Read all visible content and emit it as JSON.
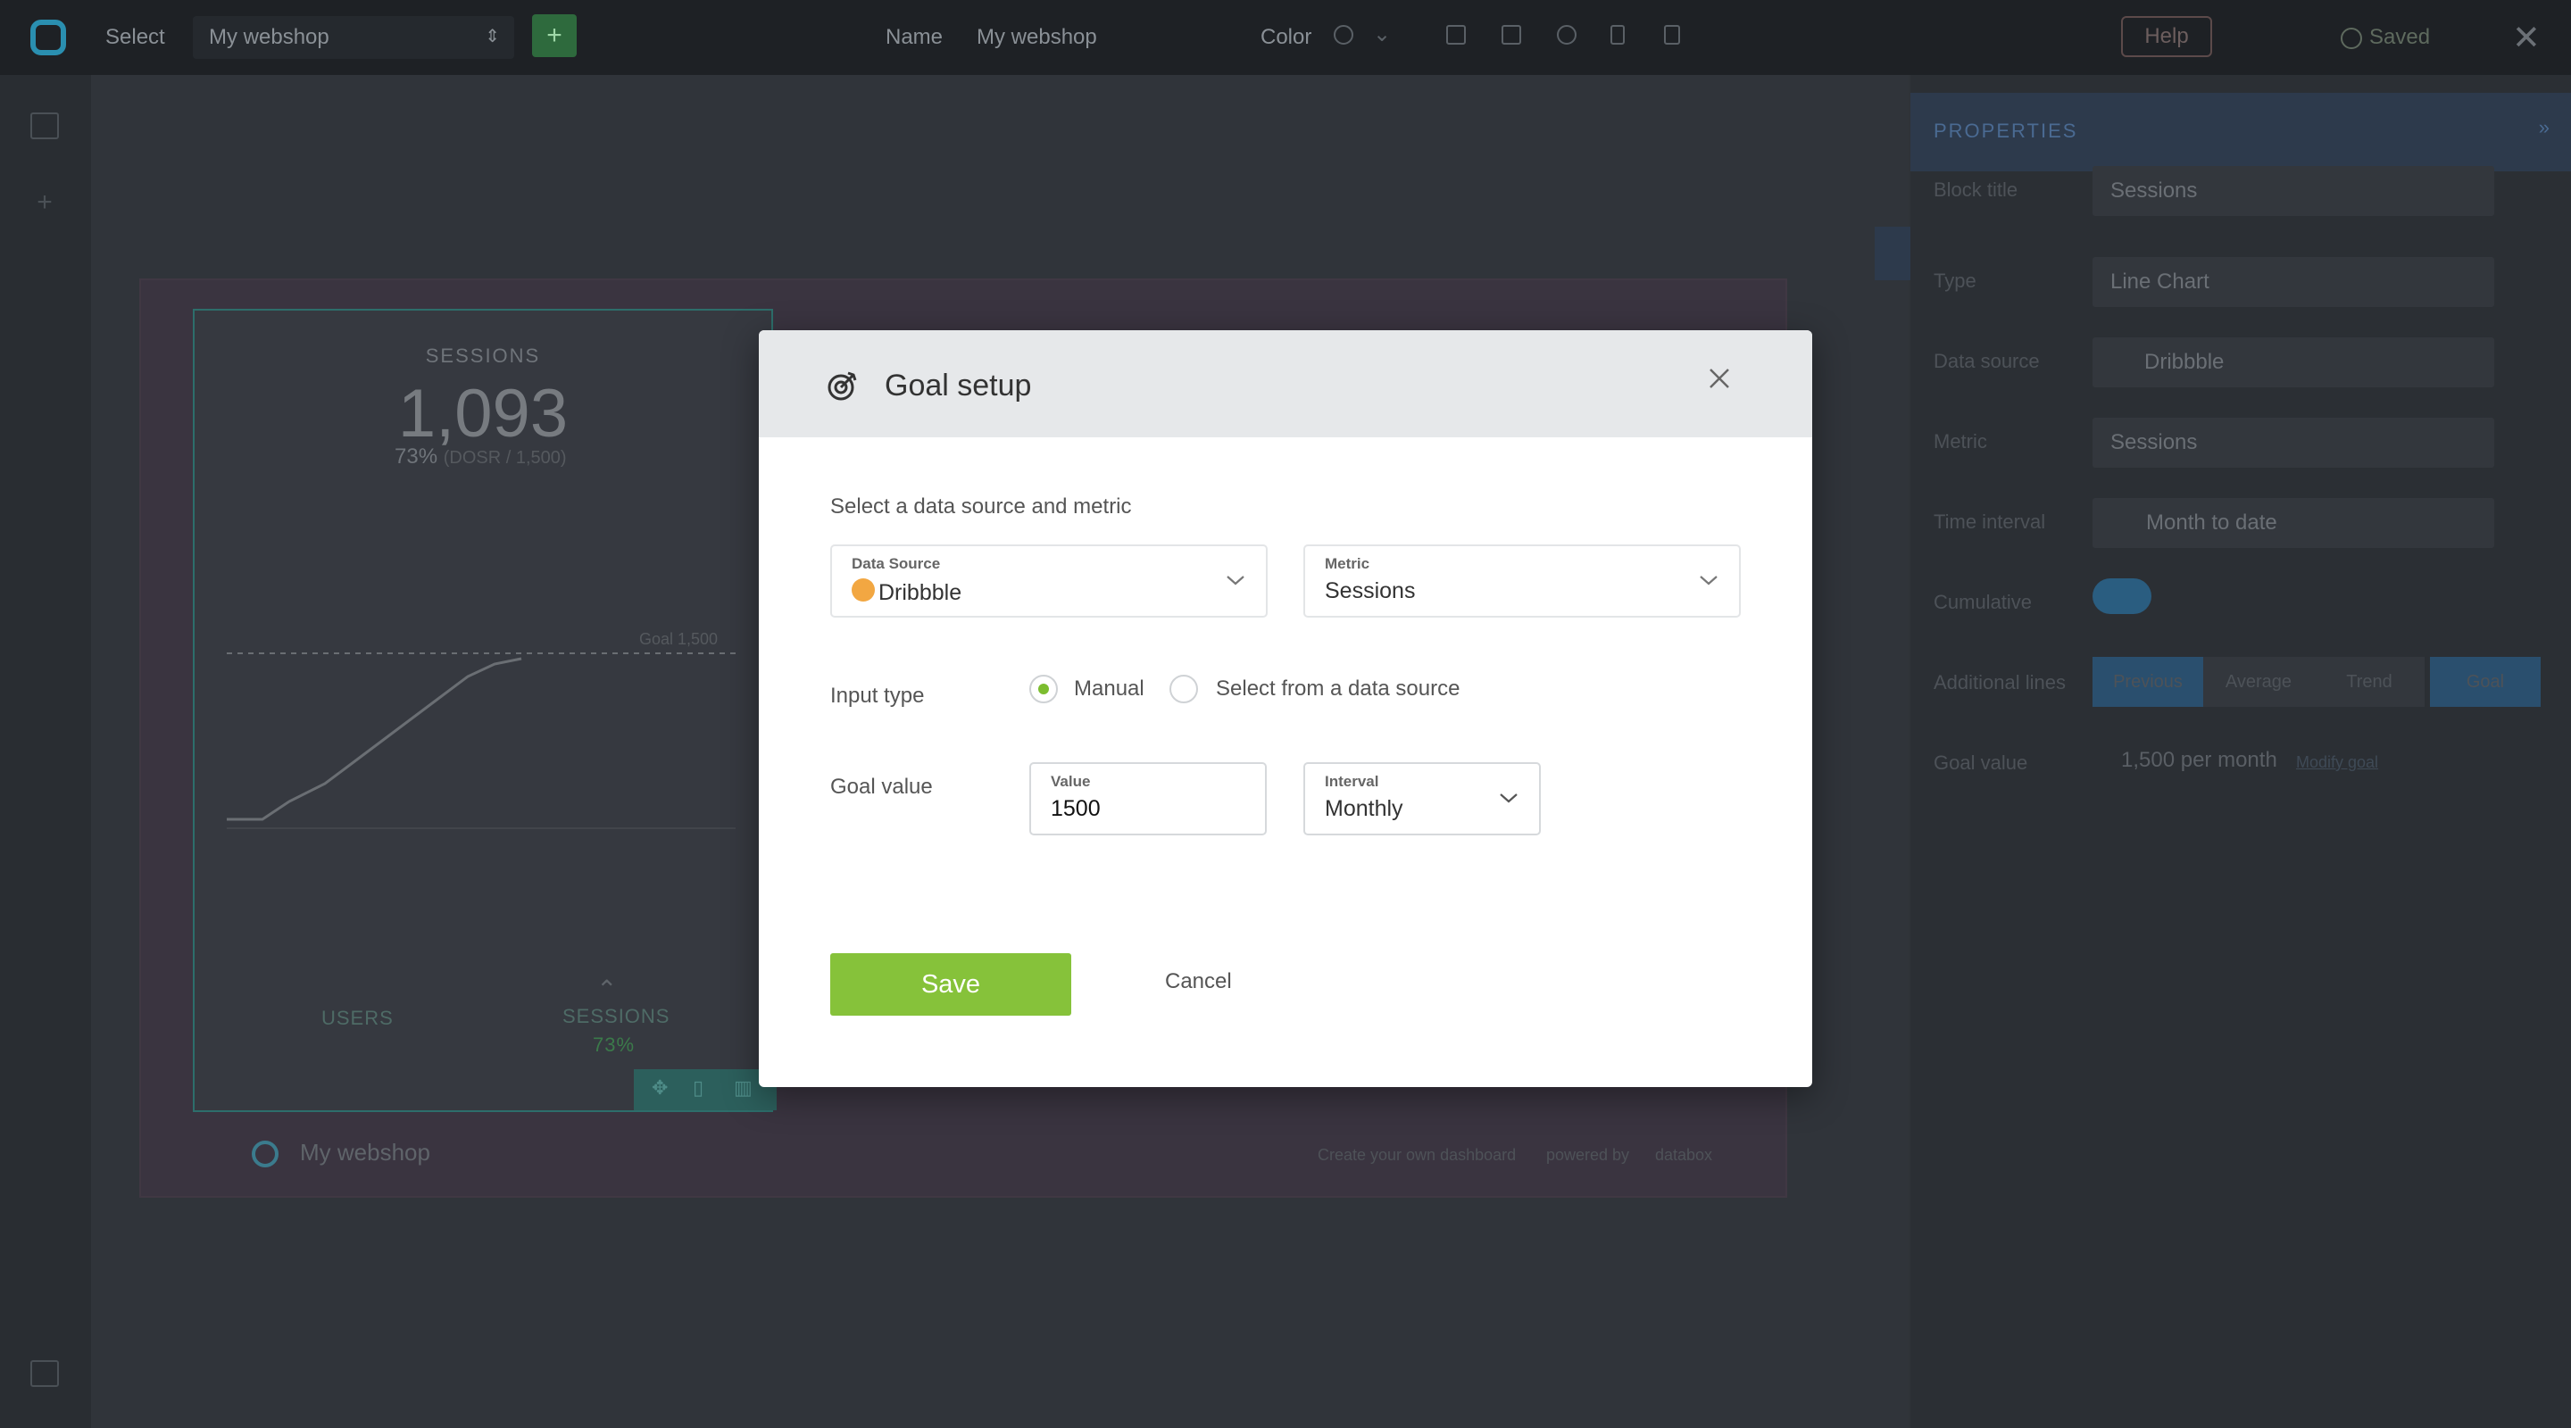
{
  "topbar": {
    "select_label": "Select",
    "dashboard_select_value": "My webshop",
    "add_label": "+",
    "name_label": "Name",
    "name_value": "My webshop",
    "color_label": "Color",
    "help_label": "Help",
    "saved_label": "Saved"
  },
  "widget": {
    "title": "SESSIONS",
    "big_value": "1,093",
    "pct": "73%",
    "pct_note": "(DOSR / 1,500)",
    "goal_line_label": "Goal 1,500",
    "bottom_users_label": "USERS",
    "bottom_sessions_label": "SESSIONS",
    "bottom_sessions_pct": "73%"
  },
  "footer": {
    "brand": "My webshop",
    "right_text_1": "Create your own dashboard",
    "right_text_2": "powered by",
    "right_text_3": "databox"
  },
  "properties": {
    "header": "PROPERTIES",
    "rows": [
      {
        "label": "Block title",
        "value": "Sessions"
      },
      {
        "label": "Type",
        "value": "Line Chart"
      },
      {
        "label": "Data source",
        "value": "Dribbble"
      },
      {
        "label": "Metric",
        "value": "Sessions"
      },
      {
        "label": "Time interval",
        "value": "Month to date"
      }
    ],
    "cumulative_label": "Cumulative",
    "additional_lines_label": "Additional lines",
    "segments": [
      "Previous",
      "Average",
      "Trend",
      "Goal"
    ],
    "goal_value_label": "Goal value",
    "goal_value_text": "1,500 per month",
    "goal_value_link": "Modify goal"
  },
  "modal": {
    "title": "Goal setup",
    "section_label": "Select a data source and metric",
    "data_source": {
      "label": "Data Source",
      "value": "Dribbble"
    },
    "metric": {
      "label": "Metric",
      "value": "Sessions"
    },
    "input_type_label": "Input type",
    "input_type_options": [
      "Manual",
      "Select from a data source"
    ],
    "input_type_selected": "Manual",
    "goal_value_label": "Goal value",
    "value_field": {
      "label": "Value",
      "value": "1500"
    },
    "interval_field": {
      "label": "Interval",
      "value": "Monthly"
    },
    "save_label": "Save",
    "cancel_label": "Cancel"
  },
  "colors": {
    "accent_green": "#86c23a",
    "radio_green": "#7cbd2f",
    "dribbble_orange": "#f2a742",
    "modal_header_bg": "#e6e8ea"
  }
}
